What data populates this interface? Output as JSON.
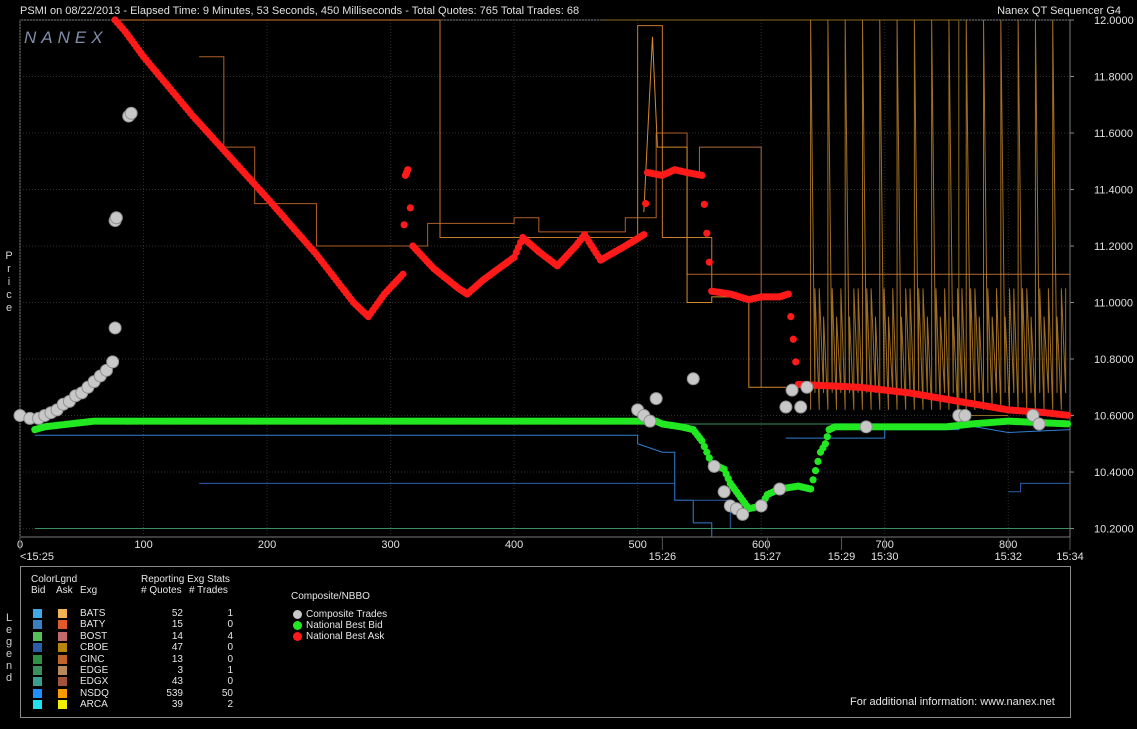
{
  "header": {
    "title": "PSMI on 08/22/2013  -  Elapsed Time: 9 Minutes, 53 Seconds, 450 Milliseconds  -  Total Quotes: 765  Total Trades: 68",
    "product": "Nanex QT Sequencer G4",
    "watermark": "NANEX"
  },
  "side_labels": {
    "price": "Price",
    "legend": "Legend"
  },
  "chart_data": {
    "type": "line",
    "title": "PSMI on 08/22/2013",
    "ylabel": "Price",
    "x_range": [
      0,
      850
    ],
    "ylim": [
      10.17,
      12.0
    ],
    "y_ticks": [
      "12.0000",
      "11.8000",
      "11.6000",
      "11.4000",
      "11.2000",
      "11.0000",
      "10.8000",
      "10.6000",
      "10.4000",
      "10.2000"
    ],
    "x_ticks": [
      "0",
      "100",
      "200",
      "300",
      "400",
      "500",
      "600",
      "700",
      "800"
    ],
    "time_labels": [
      {
        "x": 0,
        "label": "<15:25"
      },
      {
        "x": 520,
        "label": "15:26"
      },
      {
        "x": 605,
        "label": "15:27"
      },
      {
        "x": 665,
        "label": "15:29"
      },
      {
        "x": 700,
        "label": "15:30"
      },
      {
        "x": 800,
        "label": "15:32"
      },
      {
        "x": 850,
        "label": "15:34"
      }
    ],
    "grid": true,
    "series": [
      {
        "name": "National Best Ask",
        "color": "#ff1a1a",
        "points": [
          [
            77,
            12.0
          ],
          [
            85,
            11.96
          ],
          [
            100,
            11.87
          ],
          [
            140,
            11.66
          ],
          [
            200,
            11.37
          ],
          [
            240,
            11.17
          ],
          [
            270,
            11.0
          ],
          [
            282,
            10.95
          ],
          [
            295,
            11.03
          ],
          [
            310,
            11.1
          ],
          [
            312,
            11.45
          ],
          [
            314,
            11.47
          ],
          [
            318,
            11.2
          ],
          [
            335,
            11.12
          ],
          [
            355,
            11.05
          ],
          [
            362,
            11.03
          ],
          [
            375,
            11.08
          ],
          [
            400,
            11.16
          ],
          [
            407,
            11.23
          ],
          [
            420,
            11.18
          ],
          [
            435,
            11.13
          ],
          [
            450,
            11.2
          ],
          [
            457,
            11.24
          ],
          [
            470,
            11.15
          ],
          [
            490,
            11.2
          ],
          [
            505,
            11.24
          ],
          [
            508,
            11.46
          ],
          [
            520,
            11.45
          ],
          [
            530,
            11.47
          ],
          [
            540,
            11.46
          ],
          [
            552,
            11.45
          ],
          [
            560,
            11.04
          ],
          [
            575,
            11.03
          ],
          [
            590,
            11.01
          ],
          [
            600,
            11.02
          ],
          [
            615,
            11.02
          ],
          [
            622,
            11.03
          ],
          [
            630,
            10.71
          ],
          [
            680,
            10.7
          ],
          [
            720,
            10.68
          ],
          [
            760,
            10.65
          ],
          [
            800,
            10.62
          ],
          [
            830,
            10.61
          ],
          [
            850,
            10.6
          ]
        ]
      },
      {
        "name": "National Best Bid",
        "color": "#22e822",
        "points": [
          [
            12,
            10.55
          ],
          [
            20,
            10.56
          ],
          [
            40,
            10.57
          ],
          [
            60,
            10.58
          ],
          [
            100,
            10.58
          ],
          [
            300,
            10.58
          ],
          [
            500,
            10.58
          ],
          [
            515,
            10.58
          ],
          [
            520,
            10.57
          ],
          [
            535,
            10.56
          ],
          [
            545,
            10.55
          ],
          [
            552,
            10.51
          ],
          [
            560,
            10.43
          ],
          [
            570,
            10.41
          ],
          [
            575,
            10.36
          ],
          [
            580,
            10.33
          ],
          [
            585,
            10.3
          ],
          [
            590,
            10.27
          ],
          [
            600,
            10.28
          ],
          [
            605,
            10.32
          ],
          [
            615,
            10.34
          ],
          [
            630,
            10.35
          ],
          [
            640,
            10.34
          ],
          [
            648,
            10.47
          ],
          [
            652,
            10.5
          ],
          [
            655,
            10.55
          ],
          [
            660,
            10.56
          ],
          [
            700,
            10.56
          ],
          [
            750,
            10.56
          ],
          [
            770,
            10.57
          ],
          [
            800,
            10.58
          ],
          [
            850,
            10.57
          ]
        ]
      },
      {
        "name": "Composite Trades",
        "color": "#c8c8c8",
        "points": [
          [
            0,
            10.6
          ],
          [
            8,
            10.59
          ],
          [
            15,
            10.59
          ],
          [
            20,
            10.6
          ],
          [
            25,
            10.61
          ],
          [
            30,
            10.62
          ],
          [
            35,
            10.64
          ],
          [
            40,
            10.65
          ],
          [
            45,
            10.67
          ],
          [
            50,
            10.68
          ],
          [
            55,
            10.7
          ],
          [
            60,
            10.72
          ],
          [
            65,
            10.74
          ],
          [
            70,
            10.76
          ],
          [
            75,
            10.79
          ],
          [
            77,
            10.91
          ],
          [
            77,
            11.29
          ],
          [
            78,
            11.3
          ],
          [
            88,
            11.66
          ],
          [
            90,
            11.67
          ],
          [
            500,
            10.62
          ],
          [
            505,
            10.6
          ],
          [
            510,
            10.58
          ],
          [
            515,
            10.66
          ],
          [
            545,
            10.73
          ],
          [
            562,
            10.42
          ],
          [
            570,
            10.33
          ],
          [
            575,
            10.28
          ],
          [
            580,
            10.27
          ],
          [
            585,
            10.25
          ],
          [
            600,
            10.28
          ],
          [
            615,
            10.34
          ],
          [
            620,
            10.63
          ],
          [
            625,
            10.69
          ],
          [
            632,
            10.63
          ],
          [
            637,
            10.7
          ],
          [
            685,
            10.56
          ],
          [
            760,
            10.6
          ],
          [
            765,
            10.6
          ],
          [
            820,
            10.6
          ],
          [
            825,
            10.57
          ]
        ]
      }
    ]
  },
  "legend": {
    "color_legend_title": "ColorLgnd",
    "col_bid": "Bid",
    "col_ask": "Ask",
    "col_exg": "Exg",
    "stats_title": "Reporting Exg Stats",
    "col_quotes": "# Quotes",
    "col_trades": "# Trades",
    "composite_title": "Composite/NBBO",
    "rows": [
      {
        "exg": "BATS",
        "quotes": "52",
        "trades": "1",
        "bid_color": "#3fa8e6",
        "ask_color": "#f2b450"
      },
      {
        "exg": "BATY",
        "quotes": "15",
        "trades": "0",
        "bid_color": "#3a7fc0",
        "ask_color": "#e05a2a"
      },
      {
        "exg": "BOST",
        "quotes": "14",
        "trades": "4",
        "bid_color": "#57bf5a",
        "ask_color": "#c06a6a"
      },
      {
        "exg": "CBOE",
        "quotes": "47",
        "trades": "0",
        "bid_color": "#2a5fa8",
        "ask_color": "#b8860b"
      },
      {
        "exg": "CINC",
        "quotes": "13",
        "trades": "0",
        "bid_color": "#2f8f45",
        "ask_color": "#c0642a"
      },
      {
        "exg": "EDGE",
        "quotes": "3",
        "trades": "1",
        "bid_color": "#3b8f5f",
        "ask_color": "#b88a5a"
      },
      {
        "exg": "EDGX",
        "quotes": "43",
        "trades": "0",
        "bid_color": "#3a9f8f",
        "ask_color": "#a0523a"
      },
      {
        "exg": "NSDQ",
        "quotes": "539",
        "trades": "50",
        "bid_color": "#1e90ff",
        "ask_color": "#ff9900"
      },
      {
        "exg": "ARCA",
        "quotes": "39",
        "trades": "2",
        "bid_color": "#22e0f0",
        "ask_color": "#f0f000"
      }
    ],
    "composite": [
      {
        "label": "Composite Trades",
        "color": "#c8c8c8"
      },
      {
        "label": "National Best Bid",
        "color": "#22e822"
      },
      {
        "label": "National Best Ask",
        "color": "#ff1a1a"
      }
    ],
    "footer": "For additional information: www.nanex.net"
  }
}
